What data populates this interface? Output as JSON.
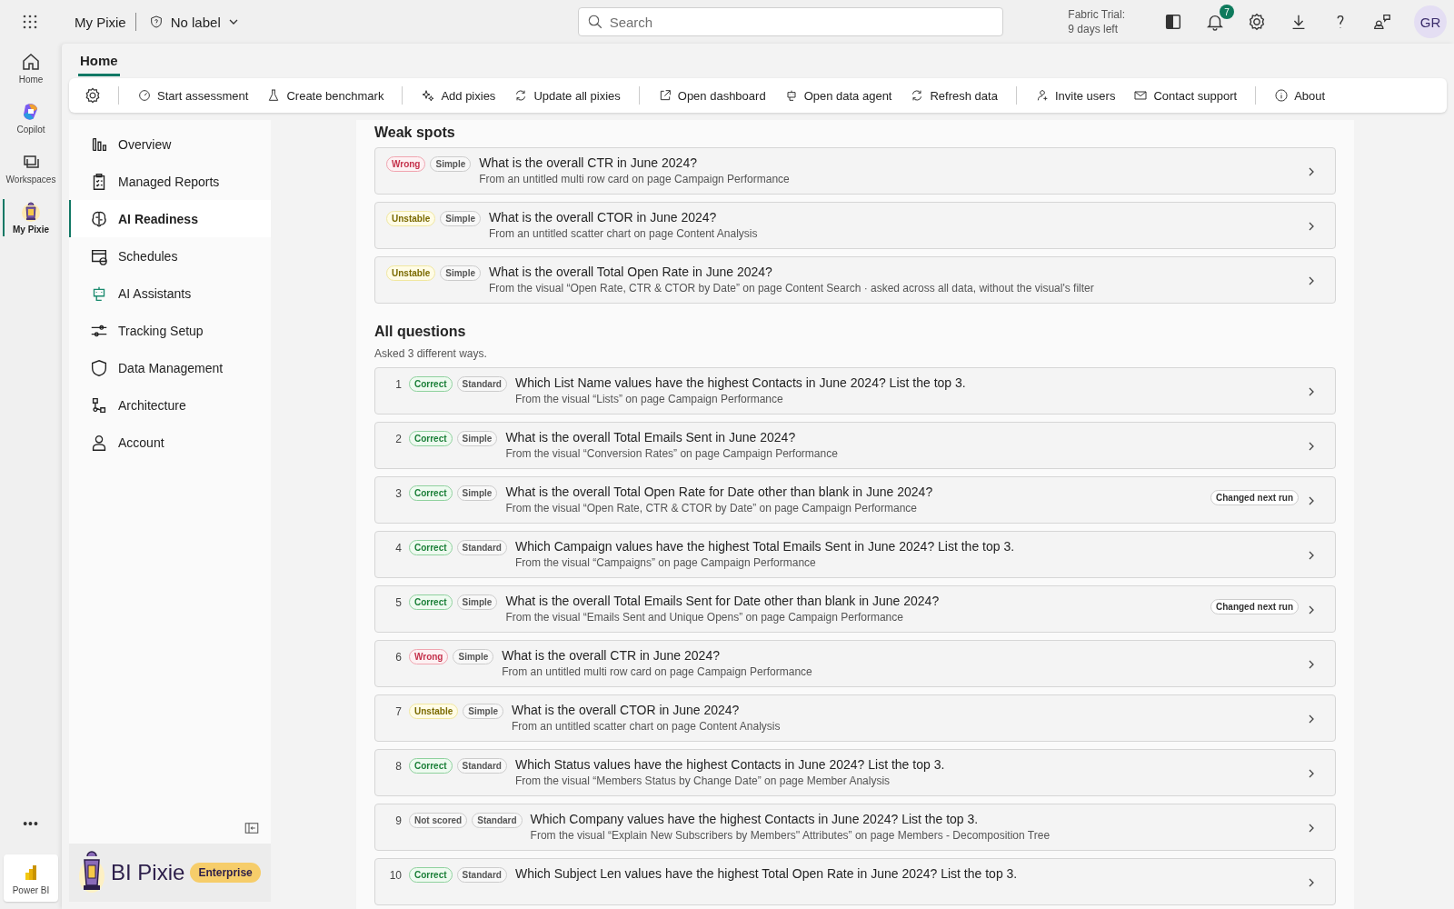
{
  "topbar": {
    "app_name": "My Pixie",
    "label": "No label",
    "search": {
      "placeholder": "Search"
    },
    "trial": [
      "Fabric Trial:",
      "9 days left"
    ],
    "notifications": "7",
    "avatar": "GR"
  },
  "rail": [
    {
      "label": "Home",
      "selected": false
    },
    {
      "label": "Copilot",
      "selected": false
    },
    {
      "label": "Workspaces",
      "selected": false
    },
    {
      "label": "My Pixie",
      "selected": true
    }
  ],
  "rail_more": "•••",
  "rail_bottom": "Power BI",
  "page_tab": {
    "label": "Home",
    "selected": true
  },
  "toolbar": [
    [
      "Start assessment",
      "Create benchmark"
    ],
    [
      "Add pixies",
      "Update all pixies"
    ],
    [
      "Open dashboard",
      "Open data agent",
      "Refresh data"
    ],
    [
      "Invite users",
      "Contact support"
    ],
    [
      "About"
    ]
  ],
  "sidebar": {
    "items": [
      {
        "label": "Overview",
        "selected": false
      },
      {
        "label": "Managed Reports",
        "selected": false
      },
      {
        "label": "AI Readiness",
        "selected": true
      },
      {
        "label": "Schedules",
        "selected": false
      },
      {
        "label": "AI Assistants",
        "selected": false
      },
      {
        "label": "Tracking Setup",
        "selected": false
      },
      {
        "label": "Data Management",
        "selected": false
      },
      {
        "label": "Architecture",
        "selected": false
      },
      {
        "label": "Account",
        "selected": false
      }
    ],
    "brand": "BI Pixie",
    "plan": "Enterprise"
  },
  "weak_spots": {
    "title": "Weak spots",
    "items": [
      {
        "status": "Wrong",
        "kind": "wrong",
        "complexity": "Simple",
        "question": "What is the overall CTR in June 2024?",
        "source": "From an untitled multi row card on page Campaign Performance"
      },
      {
        "status": "Unstable",
        "kind": "unstable",
        "complexity": "Simple",
        "question": "What is the overall CTOR in June 2024?",
        "source": "From an untitled scatter chart on page Content Analysis"
      },
      {
        "status": "Unstable",
        "kind": "unstable",
        "complexity": "Simple",
        "question": "What is the overall Total Open Rate in June 2024?",
        "source": "From the visual “Open Rate, CTR & CTOR by Date” on page Content Search · asked across all data, without the visual's filter"
      }
    ]
  },
  "all_questions": {
    "title": "All questions",
    "note": "Asked 3 different ways.",
    "items": [
      {
        "number": "1",
        "status": "Correct",
        "kind": "correct",
        "complexity": "Standard",
        "question": "Which List Name values have the highest Contacts in June 2024? List the top 3.",
        "source": "From the visual “Lists” on page Campaign Performance"
      },
      {
        "number": "2",
        "status": "Correct",
        "kind": "correct",
        "complexity": "Simple",
        "question": "What is the overall Total Emails Sent in June 2024?",
        "source": "From the visual “Conversion Rates” on page Campaign Performance"
      },
      {
        "number": "3",
        "status": "Correct",
        "kind": "correct",
        "complexity": "Simple",
        "question": "What is the overall Total Open Rate for Date other than blank in June 2024?",
        "source": "From the visual “Open Rate, CTR & CTOR by Date” on page Campaign Performance",
        "badge": "Changed next run"
      },
      {
        "number": "4",
        "status": "Correct",
        "kind": "correct",
        "complexity": "Standard",
        "question": "Which Campaign values have the highest Total Emails Sent in June 2024? List the top 3.",
        "source": "From the visual “Campaigns” on page Campaign Performance"
      },
      {
        "number": "5",
        "status": "Correct",
        "kind": "correct",
        "complexity": "Simple",
        "question": "What is the overall Total Emails Sent for Date other than blank in June 2024?",
        "source": "From the visual “Emails Sent and Unique Opens” on page Campaign Performance",
        "badge": "Changed next run"
      },
      {
        "number": "6",
        "status": "Wrong",
        "kind": "wrong",
        "complexity": "Simple",
        "question": "What is the overall CTR in June 2024?",
        "source": "From an untitled multi row card on page Campaign Performance"
      },
      {
        "number": "7",
        "status": "Unstable",
        "kind": "unstable",
        "complexity": "Simple",
        "question": "What is the overall CTOR in June 2024?",
        "source": "From an untitled scatter chart on page Content Analysis"
      },
      {
        "number": "8",
        "status": "Correct",
        "kind": "correct",
        "complexity": "Standard",
        "question": "Which Status values have the highest Contacts in June 2024? List the top 3.",
        "source": "From the visual “Members Status by Change Date” on page Member Analysis"
      },
      {
        "number": "9",
        "status": "Not scored",
        "kind": "unscored",
        "complexity": "Standard",
        "question": "Which Company values have the highest Contacts in June 2024? List the top 3.",
        "source": "From the visual “Explain New Subscribers by Members'' Attributes” on page Members - Decomposition Tree"
      },
      {
        "number": "10",
        "status": "Correct",
        "kind": "correct",
        "complexity": "Standard",
        "question": "Which Subject Len values have the highest Total Open Rate in June 2024? List the top 3."
      }
    ]
  }
}
